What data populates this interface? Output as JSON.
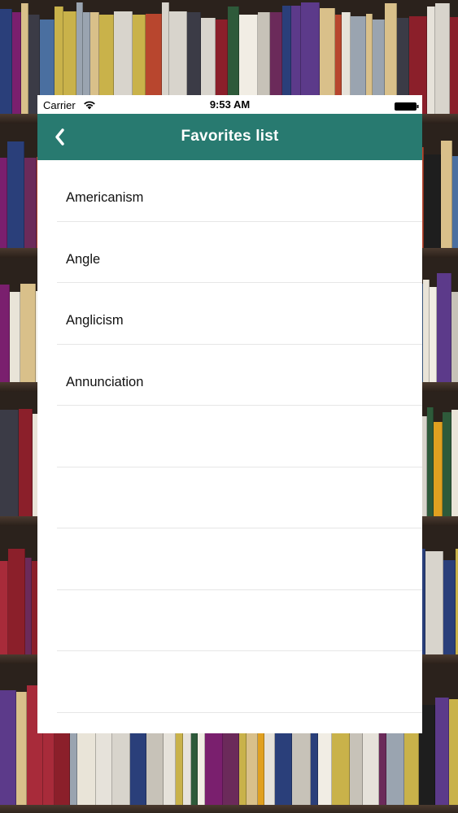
{
  "status_bar": {
    "carrier": "Carrier",
    "time": "9:53 AM",
    "wifi_icon": "wifi-icon",
    "battery_icon": "battery-full-icon"
  },
  "nav": {
    "title": "Favorites list",
    "back_icon": "chevron-left-icon",
    "background_color": "#287a70"
  },
  "favorites": [
    {
      "label": "Americanism"
    },
    {
      "label": "Angle"
    },
    {
      "label": "Anglicism"
    },
    {
      "label": "Annunciation"
    }
  ]
}
